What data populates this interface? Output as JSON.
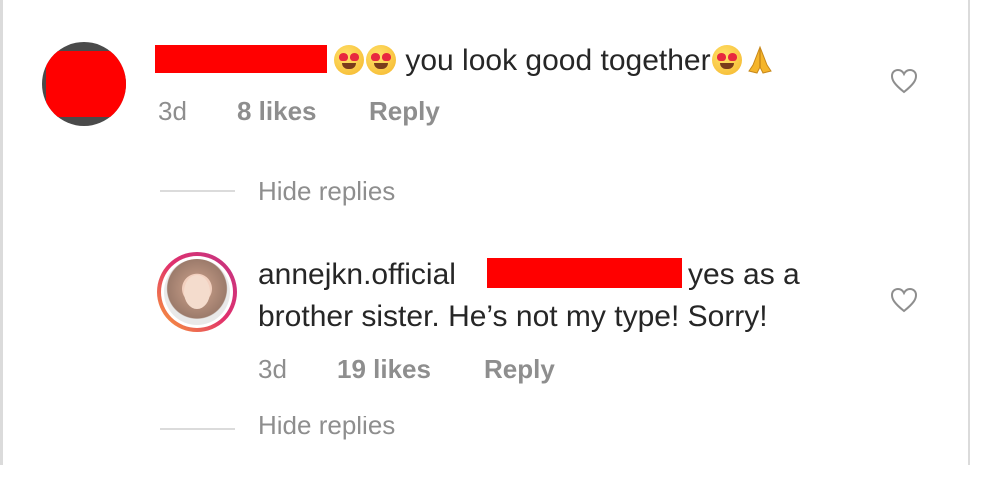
{
  "comment": {
    "text": "you look good together",
    "age": "3d",
    "likes": "8 likes",
    "reply_label": "Reply",
    "emoji_icons": [
      "heart-eyes-emoji-icon",
      "heart-eyes-emoji-icon",
      "heart-eyes-emoji-icon",
      "folded-hands-emoji-icon"
    ]
  },
  "hide_replies_top": "Hide replies",
  "reply": {
    "username": "annejkn.official",
    "text_line1": "yes as a",
    "text_line2": "brother sister. He’s not my type! Sorry!",
    "age": "3d",
    "likes": "19 likes",
    "reply_label": "Reply"
  },
  "hide_replies_bottom": "Hide replies",
  "colors": {
    "redaction": "#ff0000",
    "muted_text": "#8e8e8e",
    "divider": "#dbdbdb",
    "text": "#262626"
  }
}
